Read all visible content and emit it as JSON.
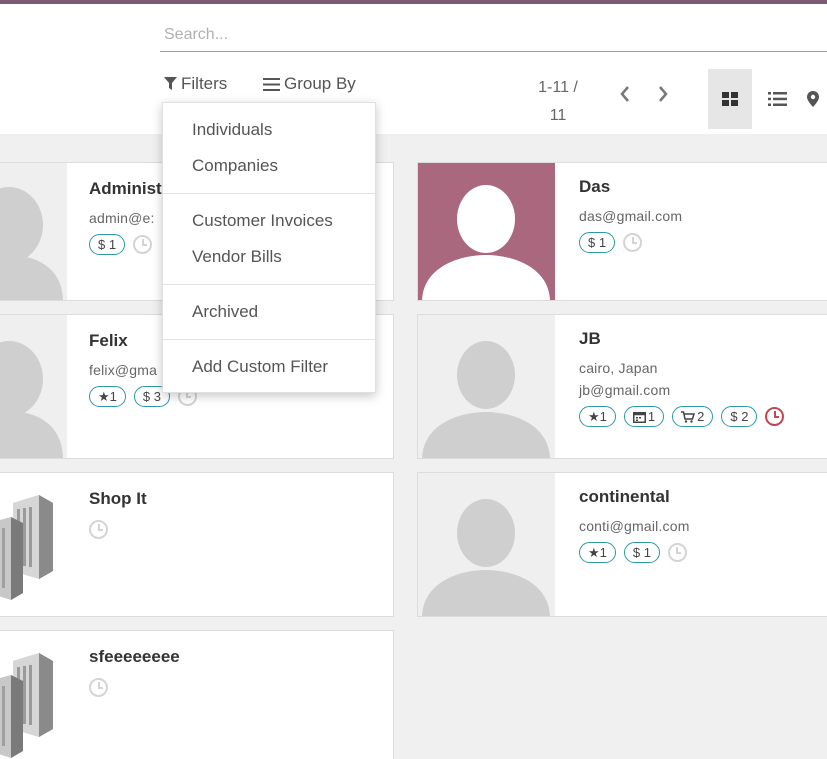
{
  "search": {
    "placeholder": "Search..."
  },
  "toolbar": {
    "filters_label": "Filters",
    "groupby_label": "Group By"
  },
  "pager": {
    "range": "1-11 /",
    "total": "11"
  },
  "views": {
    "kanban_icon": "kanban-grid-icon",
    "list_icon": "list-icon",
    "map_icon": "map-marker-icon"
  },
  "filter_menu": {
    "group1": [
      "Individuals",
      "Companies"
    ],
    "group2": [
      "Customer Invoices",
      "Vendor Bills"
    ],
    "group3": [
      "Archived"
    ],
    "group4": [
      "Add Custom Filter"
    ]
  },
  "cards": [
    {
      "name": "Administ",
      "lines": [
        "admin@e:"
      ],
      "badges": [
        "$ 1"
      ],
      "photo": "person"
    },
    {
      "name": "Das",
      "lines": [
        "das@gmail.com"
      ],
      "badges": [
        "$ 1"
      ],
      "photo": "person-pink"
    },
    {
      "name": "Felix",
      "lines": [
        "felix@gma"
      ],
      "badges": [
        "★1",
        "$ 3"
      ],
      "photo": "person"
    },
    {
      "name": "JB",
      "lines": [
        "cairo, Japan",
        "jb@gmail.com"
      ],
      "badges": [
        "★1",
        "1",
        "2",
        "$ 2"
      ],
      "photo": "person"
    },
    {
      "name": "Shop It",
      "lines": [],
      "badges": [],
      "photo": "company"
    },
    {
      "name": "continental",
      "lines": [
        "conti@gmail.com"
      ],
      "badges": [
        "★1",
        "$ 1"
      ],
      "photo": "person"
    },
    {
      "name": "sfeeeeeeee",
      "lines": [],
      "badges": [],
      "photo": "company"
    }
  ],
  "colors": {
    "brand": "#7c5a73",
    "badge_border": "#2d9aa3",
    "activity_overdue": "#c44553",
    "avatar_pink": "#a9687d"
  }
}
